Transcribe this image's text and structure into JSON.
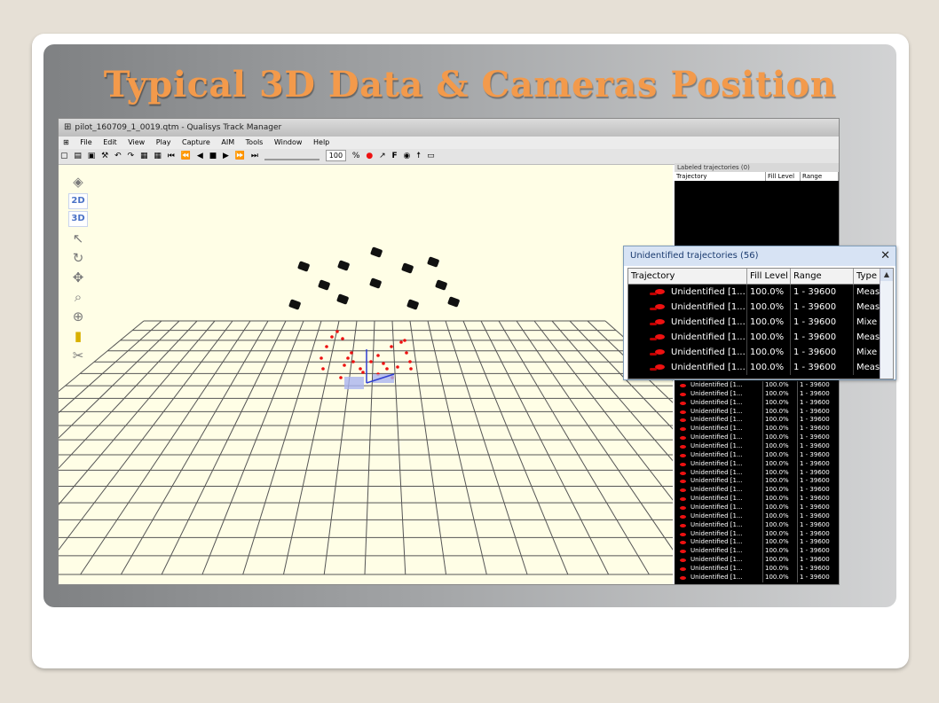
{
  "slide": {
    "title": "Typical 3D Data & Cameras Position"
  },
  "window": {
    "title": "pilot_160709_1_0019.qtm - Qualisys Track Manager"
  },
  "menu": [
    "File",
    "Edit",
    "View",
    "Play",
    "Capture",
    "AIM",
    "Tools",
    "Window",
    "Help"
  ],
  "toolbar": {
    "zoom_value": "100",
    "zoom_unit": "%"
  },
  "sidetools": {
    "mode_2d": "2D",
    "mode_3d": "3D"
  },
  "labeled_panel": {
    "title": "Labeled trajectories (0)",
    "columns": [
      "Trajectory",
      "Fill Level",
      "Range"
    ]
  },
  "unidentified_panel": {
    "title": "Unidentified trajectories (56)",
    "close": "✕",
    "columns": [
      "Trajectory",
      "Fill Level",
      "Range",
      "Type"
    ],
    "rows": [
      {
        "name": "Unidentified [1...",
        "fill": "100.0%",
        "range": "1 - 39600",
        "type": "Meas"
      },
      {
        "name": "Unidentified [1...",
        "fill": "100.0%",
        "range": "1 - 39600",
        "type": "Meas"
      },
      {
        "name": "Unidentified [1...",
        "fill": "100.0%",
        "range": "1 - 39600",
        "type": "Mixe"
      },
      {
        "name": "Unidentified [1...",
        "fill": "100.0%",
        "range": "1 - 39600",
        "type": "Meas"
      },
      {
        "name": "Unidentified [1...",
        "fill": "100.0%",
        "range": "1 - 39600",
        "type": "Mixe"
      },
      {
        "name": "Unidentified [1...",
        "fill": "100.0%",
        "range": "1 - 39600",
        "type": "Meas"
      }
    ]
  },
  "background_rows": {
    "name": "Unidentified [1...",
    "fill": "100.0%",
    "range": "1 - 39600",
    "count": 23
  }
}
